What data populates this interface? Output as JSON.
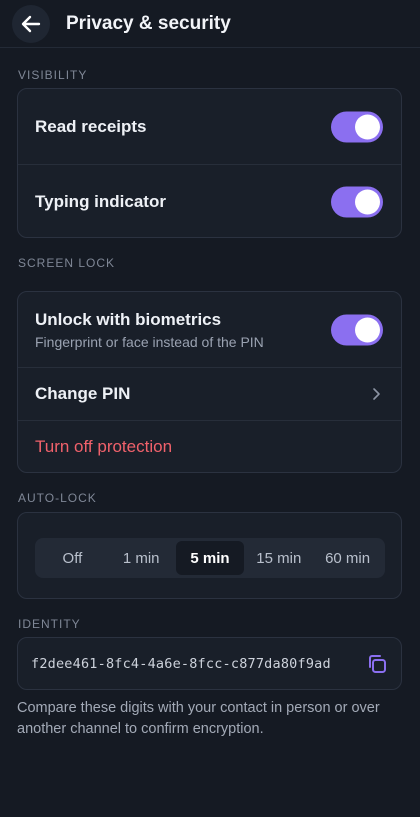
{
  "header": {
    "title": "Privacy & security"
  },
  "visibility": {
    "label": "VISIBILITY",
    "read_receipts": {
      "label": "Read receipts",
      "on": true
    },
    "typing_indicator": {
      "label": "Typing indicator",
      "on": true
    }
  },
  "screen_lock": {
    "label": "SCREEN LOCK",
    "biometrics": {
      "label": "Unlock with biometrics",
      "sub": "Fingerprint or face instead of the PIN",
      "on": true
    },
    "change_pin": {
      "label": "Change PIN"
    },
    "turn_off": {
      "label": "Turn off protection"
    }
  },
  "auto_lock": {
    "label": "AUTO-LOCK",
    "options": [
      "Off",
      "1 min",
      "5 min",
      "15 min",
      "60 min"
    ],
    "selected": "5 min"
  },
  "identity": {
    "label": "IDENTITY",
    "value": "f2dee461-8fc4-4a6e-8fcc-c877da80f9ad",
    "hint": "Compare these digits with your contact in person or over another channel to confirm encryption."
  },
  "colors": {
    "background": "#151a23",
    "card": "#191f29",
    "accent": "#8b6ff0",
    "danger": "#f0616b"
  },
  "icons": {
    "back": "arrow-left-icon",
    "chevron": "chevron-right-icon",
    "copy": "copy-icon"
  }
}
